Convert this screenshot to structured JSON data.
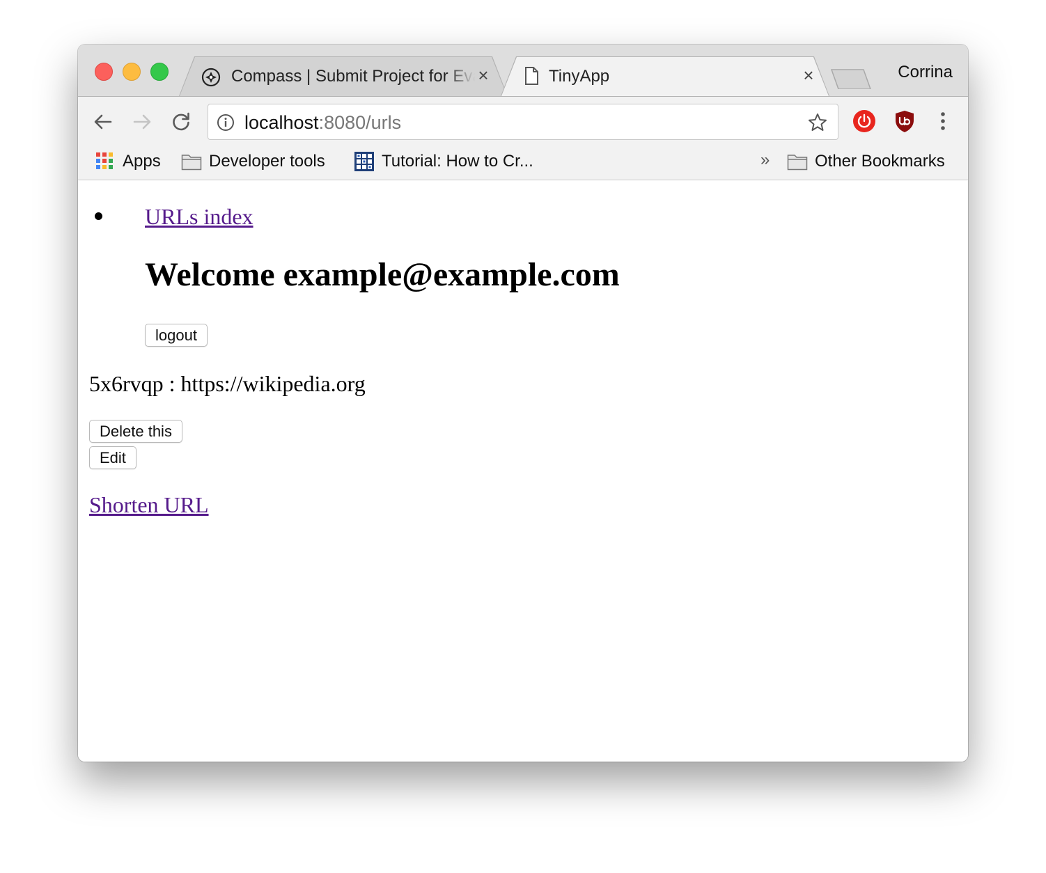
{
  "browser": {
    "tabs": [
      {
        "title": "Compass | Submit Project for Evaluation",
        "active": false
      },
      {
        "title": "TinyApp",
        "active": true
      }
    ],
    "profile_name": "Corrina",
    "address": {
      "host": "localhost",
      "rest": ":8080/urls"
    },
    "bookmarks": [
      {
        "label": "Apps",
        "icon": "apps-grid-icon"
      },
      {
        "label": "Developer tools",
        "icon": "folder-icon"
      },
      {
        "label": "Tutorial: How to Cr...",
        "icon": "grid-favicon-icon"
      },
      {
        "label": "Other Bookmarks",
        "icon": "folder-icon"
      }
    ],
    "overflow_chevron": "»"
  },
  "page": {
    "nav": {
      "urls_index": "URLs index"
    },
    "welcome": "Welcome example@example.com",
    "logout_label": "logout",
    "url_entry": {
      "short_id": "5x6rvqp",
      "separator": " : ",
      "long_url": "https://wikipedia.org"
    },
    "delete_label": "Delete this",
    "edit_label": "Edit",
    "shorten_link": "Shorten URL"
  },
  "colors": {
    "visited_link": "#551a8b",
    "close_light": "#fc605c",
    "minimize_light": "#fdbc40",
    "maximize_light": "#34c84a"
  }
}
